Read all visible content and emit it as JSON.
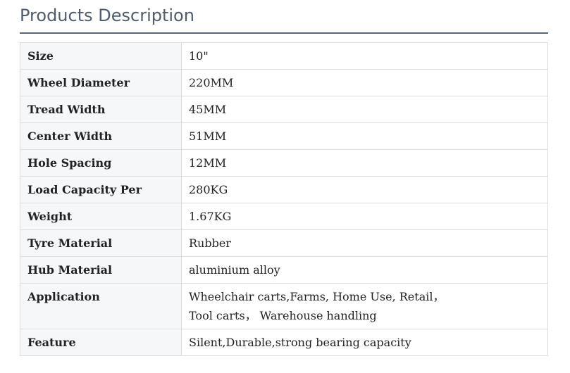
{
  "section": {
    "title": "Products Description"
  },
  "specs": [
    {
      "label": "Size",
      "value": "10\""
    },
    {
      "label": "Wheel Diameter",
      "value": "220MM"
    },
    {
      "label": "Tread Width",
      "value": "45MM"
    },
    {
      "label": "Center Width",
      "value": "51MM"
    },
    {
      "label": "Hole Spacing",
      "value": "12MM"
    },
    {
      "label": "Load Capacity Per",
      "value": "280KG"
    },
    {
      "label": "Weight",
      "value": "1.67KG"
    },
    {
      "label": "Tyre Material",
      "value": "Rubber"
    },
    {
      "label": "Hub Material",
      "value": "aluminium alloy"
    },
    {
      "label": "Application",
      "value": "Wheelchair carts,Farms, Home Use, Retail， Tool carts， Warehouse handling"
    },
    {
      "label": "Feature",
      "value": "Silent,Durable,strong bearing capacity"
    }
  ],
  "colors": {
    "title": "#4f5b6e",
    "rule": "#59667a",
    "label_cell_bg": "#f6f7f9",
    "border": "#dcdcdc"
  }
}
